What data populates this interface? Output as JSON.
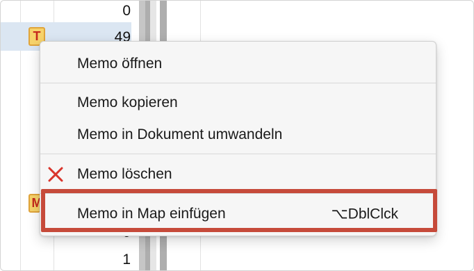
{
  "table": {
    "rows": [
      {
        "value": "0",
        "selected": false
      },
      {
        "value": "49",
        "selected": true,
        "icon": "memo-icon-T",
        "icon_letter": "T"
      },
      {
        "value": "0",
        "selected": false,
        "icon": "memo-icon-M",
        "icon_letter": "M"
      },
      {
        "value": "1",
        "selected": false
      }
    ]
  },
  "context_menu": {
    "items": [
      {
        "label": "Memo öffnen"
      },
      {
        "label": "Memo kopieren"
      },
      {
        "label": "Memo in Dokument umwandeln"
      },
      {
        "label": "Memo löschen",
        "icon": "delete-x-icon"
      },
      {
        "label": "Memo in Map einfügen",
        "shortcut": "⌥DblClck",
        "highlighted": true
      }
    ]
  },
  "colors": {
    "selection": "#dbe6f2",
    "highlight_border": "#c64a3a",
    "delete_icon": "#d9342b",
    "memo_icon_fill": "#f7d36b",
    "memo_icon_letter": "#c62a1d"
  }
}
